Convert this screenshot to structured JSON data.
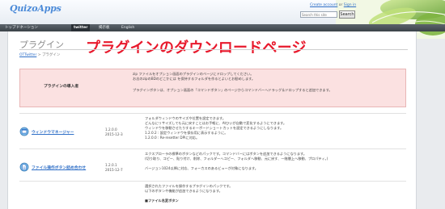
{
  "header": {
    "logo": "QuizoApps",
    "account_links": [
      "Create account",
      "Sign in"
    ],
    "search_placeholder": "Search this site",
    "search_button": "Search"
  },
  "nav": {
    "items": [
      "トップ",
      "ドネーション",
      "twitter",
      "掲示板",
      "English"
    ]
  },
  "page": {
    "title": "プラグイン",
    "overlay_title": "プラグインのダウンロードページ",
    "breadcrumb": [
      "OTTwitter",
      "プラグイン"
    ],
    "breadcrumb_sep": " > "
  },
  "intro": {
    "label": "プラグインの導入者",
    "lines": [
      "zip ファイルをオプション画面のプラグインのページにドロップしてください。",
      "お志のzipのBDのどこかには を保持するフォルダを作るとよいとお勧めします。",
      "",
      "プラグインボタンは、オプション画面の「コマンドボタン」のページからコマンドバーへドラッグ＆ドロップすると追加できます。"
    ]
  },
  "plugins": [
    {
      "name": "ウィンドウマネージャー",
      "version": "1.2.0.0",
      "date": "2015-12-3",
      "lines": [
        "フォルダウィンドウのサイズや位置を設定できます。",
        "どんなにリサイズしても元に戻すことはお手軽に、Atひいが自動で変化するようにできます。",
        "ウィンドウを移動させたりするキーボードショートカットを設定できるようにしなります。",
        "1.2.0.2 : 設定ウィンドウを保存用に表示するように。",
        "1.2.0.0 : Re-resetter DPIに対応。"
      ]
    },
    {
      "name": "ファイル操作ボタン詰め合わせ",
      "version": "1.2.0.1",
      "date": "2015-12-7",
      "lines": [
        "エクスプローラの標準のボタンなどのパックです。コマンドバーにはボタンを追加できるようになります。",
        "(切り取り、コピー、貼り付け、削除、フォルダーへコピー、フォルダへ移動、元に戻す、一階層上へ移動、プロパティ。)",
        "",
        "バージョン1024以降に対応、フォーカスのあるビューが対象になります。"
      ]
    },
    {
      "lines": [
        "選択されたファイルを操作するプラグインのパックです。",
        "以下のボタンや機能が追加できるようになります。",
        "",
        "■ファイル名変ボタン"
      ]
    }
  ],
  "colors": {
    "accent": "#2f6fc7",
    "overlay_red": "#e8192c",
    "intro_bg": "#fbe1e1",
    "navbar": "#4a5158"
  }
}
